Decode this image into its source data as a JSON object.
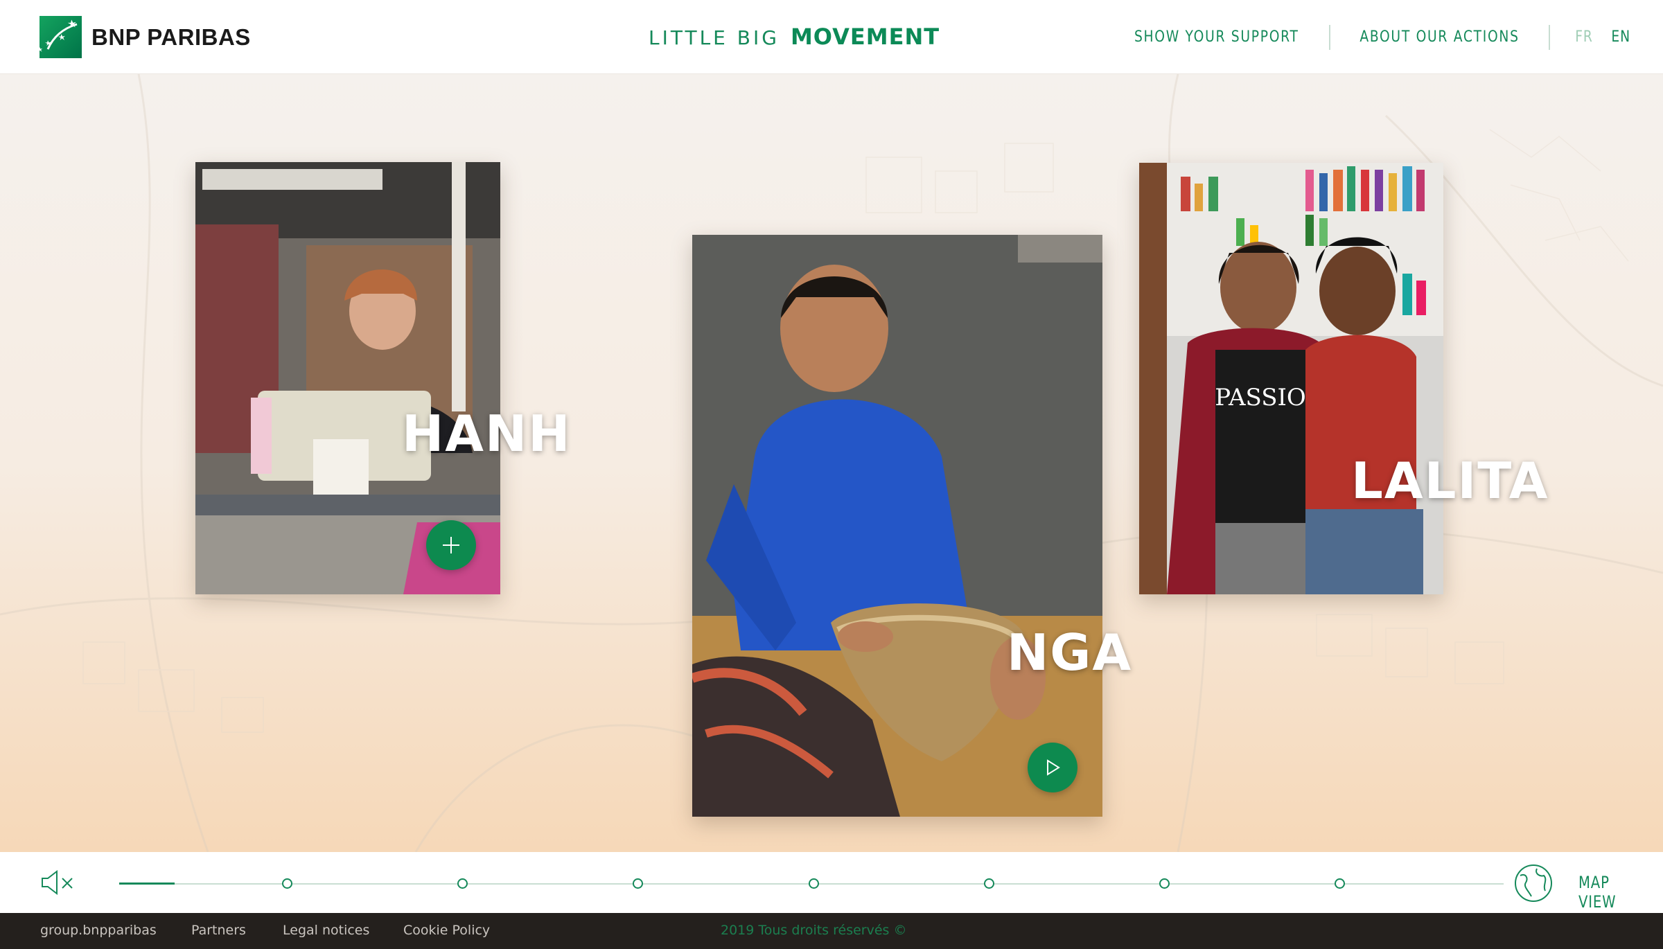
{
  "header": {
    "logo_text": "BNP PARIBAS",
    "brand_light": "LITTLE BIG",
    "brand_bold": "MOVEMENT",
    "nav": {
      "show_support": "SHOW YOUR SUPPORT",
      "about_actions": "ABOUT OUR ACTIONS",
      "lang_fr": "FR",
      "lang_en": "EN"
    }
  },
  "stories": [
    {
      "name": "HANH",
      "action": "plus-icon"
    },
    {
      "name": "NGA",
      "action": "play-icon"
    },
    {
      "name": "LALITA",
      "action": ""
    }
  ],
  "timeline": {
    "progress": 0.04,
    "map_view": "MAP VIEW",
    "mute_icon": "speaker-muted-icon",
    "globe_icon": "globe-icon"
  },
  "footer": {
    "links": [
      "group.bnpparibas",
      "Partners",
      "Legal notices",
      "Cookie Policy"
    ],
    "copyright": "2019 Tous droits réservés ©"
  },
  "colors": {
    "brand_green": "#15895a",
    "button_green": "#0d8a4f",
    "footer_bg": "#24201d"
  }
}
